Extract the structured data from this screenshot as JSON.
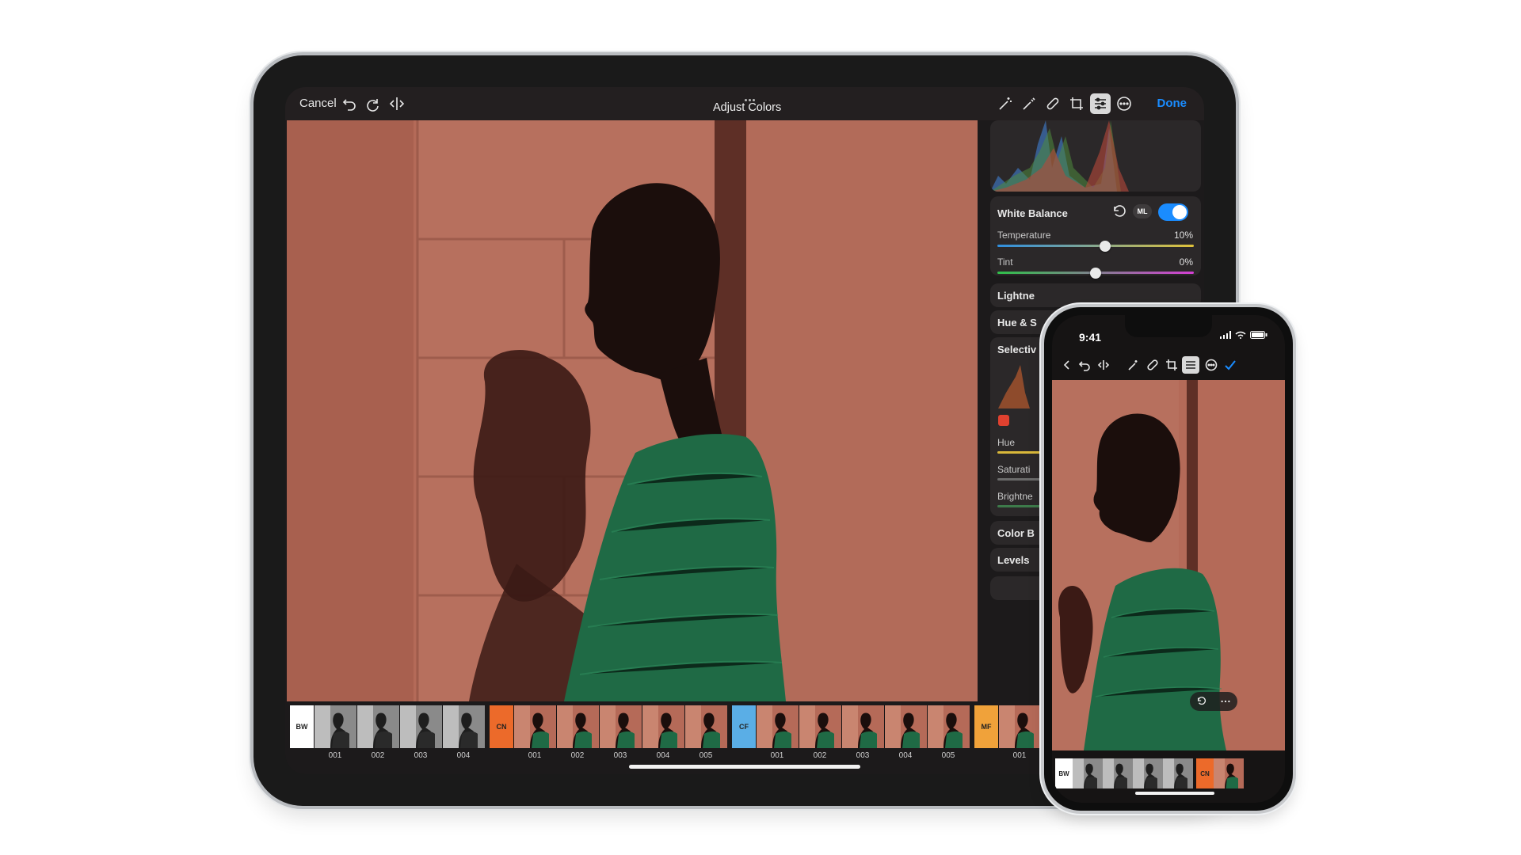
{
  "ipad": {
    "toolbar": {
      "cancel_label": "Cancel",
      "title": "Adjust Colors",
      "done_label": "Done",
      "icons": [
        "undo-icon",
        "redo-icon",
        "compare-icon",
        "magic-wand-ml-icon",
        "retouch-ml-icon",
        "bandage-icon",
        "crop-icon",
        "adjust-sliders-icon",
        "more-icon"
      ]
    },
    "panel": {
      "white_balance": {
        "title": "White Balance",
        "ml_badge": "ML",
        "toggle_on": true,
        "temperature_label": "Temperature",
        "temperature_value": "10%",
        "temperature_level": 0.55,
        "tint_label": "Tint",
        "tint_value": "0%",
        "tint_level": 0.5
      },
      "sections": [
        "Lightne",
        "Hue & S",
        "Selectiv"
      ],
      "selective": {
        "hue_label": "Hue",
        "saturation_label": "Saturati",
        "brightness_label": "Brightne"
      },
      "more_sections": [
        "Color B",
        "Levels"
      ]
    },
    "filmstrip": {
      "groups": [
        {
          "tag": "BW",
          "color": "#ffffff",
          "labels": [
            "001",
            "002",
            "003",
            "004"
          ]
        },
        {
          "tag": "CN",
          "color": "#ec6a2a",
          "labels": [
            "001",
            "002",
            "003",
            "004",
            "005"
          ]
        },
        {
          "tag": "CF",
          "color": "#5aaee6",
          "labels": [
            "001",
            "002",
            "003",
            "004",
            "005"
          ]
        },
        {
          "tag": "MF",
          "color": "#f0a23a",
          "labels": [
            "001"
          ]
        }
      ]
    }
  },
  "iphone": {
    "time": "9:41",
    "icons": [
      "back-icon",
      "undo-icon",
      "compare-icon",
      "magic-wand-ml-icon",
      "bandage-icon",
      "crop-icon",
      "adjust-sliders-icon",
      "more-icon",
      "checkmark-icon"
    ],
    "filmstrip": {
      "groups": [
        {
          "tag": "BW",
          "color": "#ffffff"
        },
        {
          "tag": "CN",
          "color": "#ec6a2a"
        }
      ]
    },
    "overlay_icons": [
      "reset-icon",
      "more-icon"
    ]
  },
  "colors": {
    "wall": "#b56a58",
    "accent_blue": "#1a8cff",
    "dress_green": "#1f6a45"
  }
}
